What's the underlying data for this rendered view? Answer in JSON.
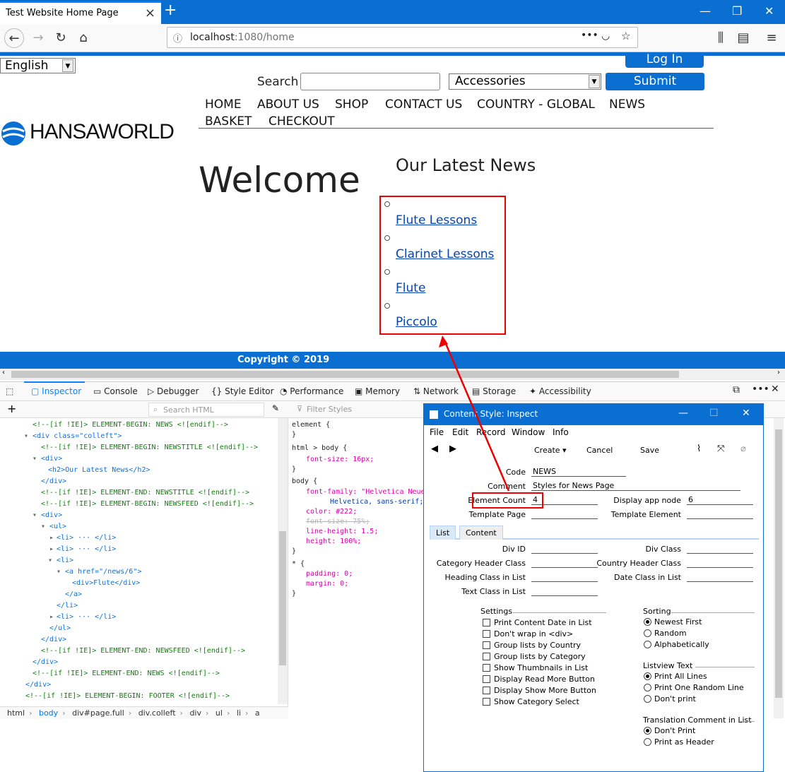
{
  "browser": {
    "tab_title": "Test Website Home Page",
    "url_host": "localhost",
    "url_path": ":1080/home"
  },
  "page": {
    "language": "English",
    "login": "Log In",
    "search_label": "Search",
    "search_value": "",
    "category": "Accessories",
    "submit": "Submit",
    "menu": [
      "HOME",
      "ABOUT US",
      "SHOP",
      "CONTACT US",
      "COUNTRY - GLOBAL",
      "NEWS",
      "BASKET",
      "CHECKOUT"
    ],
    "logo_text": "HANSAWORLD",
    "welcome": "Welcome",
    "news_title": "Our Latest News",
    "news_items": [
      "Flute Lessons",
      "Clarinet Lessons",
      "Flute",
      "Piccolo"
    ],
    "footer": "Copyright © 2019"
  },
  "devtools": {
    "tabs": [
      "Inspector",
      "Console",
      "Debugger",
      "Style Editor",
      "Performance",
      "Memory",
      "Network",
      "Storage",
      "Accessibility"
    ],
    "search_html_placeholder": "Search HTML",
    "filter_styles_placeholder": "Filter Styles",
    "html_lines": [
      "<!--[if !IE]> ELEMENT-BEGIN: NEWS <![endif]-->",
      "<div class=\"colleft\">",
      "<!--[if !IE]> ELEMENT-BEGIN: NEWSTITLE <![endif]-->",
      "<div>",
      "<h2>Our Latest News</h2>",
      "</div>",
      "<!--[if !IE]> ELEMENT-END: NEWSTITLE <![endif]-->",
      "<!--[if !IE]> ELEMENT-BEGIN: NEWSFEED <![endif]-->",
      "<div>",
      "<ul>",
      "<li> ··· </li>",
      "<li> ··· </li>",
      "<li>",
      "<a href=\"/news/6\">",
      "<div>Flute</div>",
      "</a>",
      "</li>",
      "<li> ··· </li>",
      "</ul>",
      "</div>",
      "<!--[if !IE]> ELEMENT-END: NEWSFEED <![endif]-->",
      "</div>",
      "<!--[if !IE]> ELEMENT-END: NEWS <![endif]-->",
      "</div>",
      "<!--[if !IE]> ELEMENT-BEGIN: FOOTER <![endif]-->"
    ],
    "style_lines": [
      "element { ",
      "}",
      "html > body { ",
      "font-size: 16px;",
      "}",
      "body { ",
      "font-family: \"Helvetica Neue\",",
      "Helvetica, sans-serif;",
      "color: #222;",
      "font-size: 75%;",
      "line-height: 1.5;",
      "height: 100%;",
      "}",
      "* { ",
      "padding: 0;",
      "margin: 0;",
      "}"
    ],
    "breadcrumbs": [
      "html",
      "body",
      "div#page.full",
      "div.colleft",
      "div",
      "ul",
      "li",
      "a"
    ]
  },
  "dialog": {
    "title": "Content Style: Inspect",
    "menu": [
      "File",
      "Edit",
      "Record",
      "Window",
      "Info"
    ],
    "toolbar": [
      "Create",
      "Cancel",
      "Save"
    ],
    "code_label": "Code",
    "code": "NEWS",
    "comment_label": "Comment",
    "comment": "Styles for News Page",
    "element_count_label": "Element Count",
    "element_count": "4",
    "display_app_node_label": "Display app node",
    "display_app_node": "6",
    "template_page_label": "Template Page",
    "template_element_label": "Template Element",
    "tabs": [
      "List",
      "Content"
    ],
    "div_id_label": "Div ID",
    "div_class_label": "Div Class",
    "category_header_class_label": "Category Header Class",
    "country_header_class_label": "Country Header Class",
    "heading_class_label": "Heading Class in List",
    "date_class_label": "Date Class in List",
    "text_class_label": "Text Class in List",
    "settings_label": "Settings",
    "settings": [
      "Print Content Date in List",
      "Don't wrap in <div>",
      "Group lists by Country",
      "Group lists by Category",
      "Show Thumbnails in List",
      "Display Read More Button",
      "Display Show More Button",
      "Show Category Select"
    ],
    "sorting_label": "Sorting",
    "sorting": [
      "Newest First",
      "Random",
      "Alphabetically"
    ],
    "listview_label": "Listview Text",
    "listview": [
      "Print All Lines",
      "Print One Random Line",
      "Don't print"
    ],
    "translation_label": "Translation Comment in List",
    "translation": [
      "Don't Print",
      "Print as Header"
    ]
  }
}
